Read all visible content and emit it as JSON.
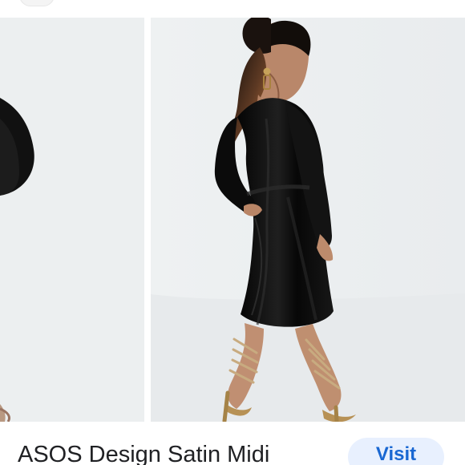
{
  "product": {
    "title": "ASOS Design Satin Midi"
  },
  "actions": {
    "visit_label": "Visit"
  },
  "colors": {
    "background": "#ffffff",
    "photo_background": "#eceff0",
    "dress": "#101010",
    "visit_background": "#e8f0fe",
    "visit_text": "#1967d2"
  },
  "images": [
    {
      "name": "previous-product-photo",
      "description": "partial black satin dress photo"
    },
    {
      "name": "current-product-photo",
      "description": "model wearing black satin midi dress"
    }
  ]
}
